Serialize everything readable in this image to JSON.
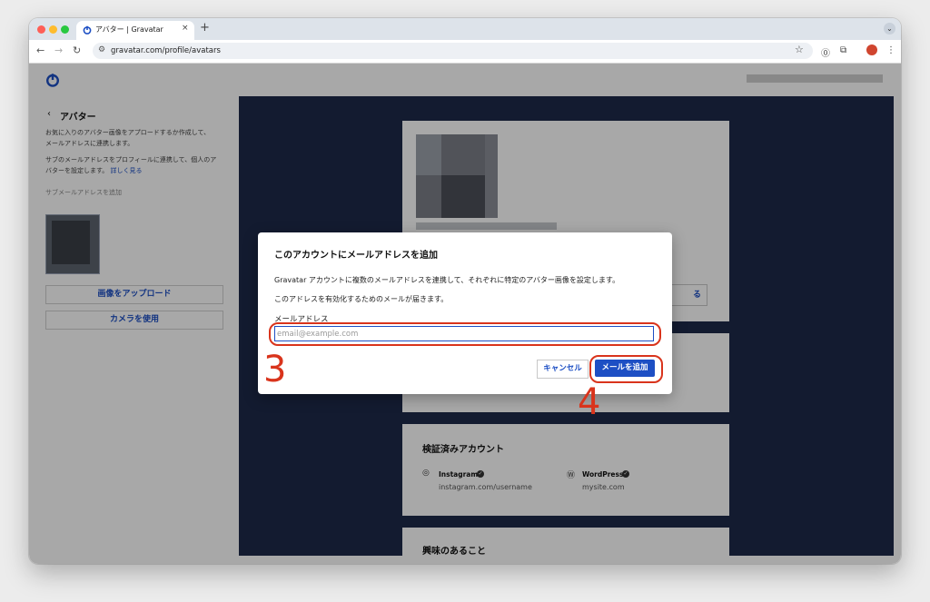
{
  "browser": {
    "tab_title": "アバター | Gravatar",
    "tab_close": "×",
    "new_tab": "+",
    "tab_menu": "⌄",
    "url": "gravatar.com/profile/avatars",
    "back": "←",
    "forward": "→",
    "reload": "↻",
    "site_info": "⚙",
    "bookmark": "☆",
    "menu": "⋮",
    "ext_1": "⓪",
    "ext_2": "⧉"
  },
  "sidebar": {
    "back_arrow": "‹",
    "title": "アバター",
    "desc1_line1": "お気に入りのアバター画像をアプロードするか作成して、",
    "desc1_line2": "メールアドレスに連携します。",
    "desc2_line1": "サブのメールアドレスをプロフィールに連携して、個人のア",
    "desc2_line2": "バターを設定します。",
    "learn_more": "詳しく見る",
    "add_sub_email": "サブメールアドレスを追加",
    "upload_button": "画像をアップロード",
    "camera_button": "カメラを使用"
  },
  "main": {
    "card_button_fragment": "る",
    "verified_title": "検証済みアカウント",
    "accounts": [
      {
        "name": "Instagram",
        "url": "instagram.com/username",
        "icon": "instagram-icon"
      },
      {
        "name": "WordPress",
        "url": "mysite.com",
        "icon": "wordpress-icon"
      }
    ],
    "interests_title": "興味のあること"
  },
  "modal": {
    "title": "このアカウントにメールアドレスを追加",
    "text1": "Gravatar アカウントに複数のメールアドレスを連携して、それぞれに特定のアバター画像を設定します。",
    "text2": "このアドレスを有効化するためのメールが届きます。",
    "email_label": "メールアドレス",
    "email_placeholder": "email@example.com",
    "email_value": "",
    "cancel_button": "キャンセル",
    "add_button": "メールを追加"
  },
  "annotations": {
    "step3": "3",
    "step4": "4"
  },
  "colors": {
    "accent": "#1d4fc4",
    "panel": "#1e2a4a",
    "annotation": "#d9341c"
  }
}
